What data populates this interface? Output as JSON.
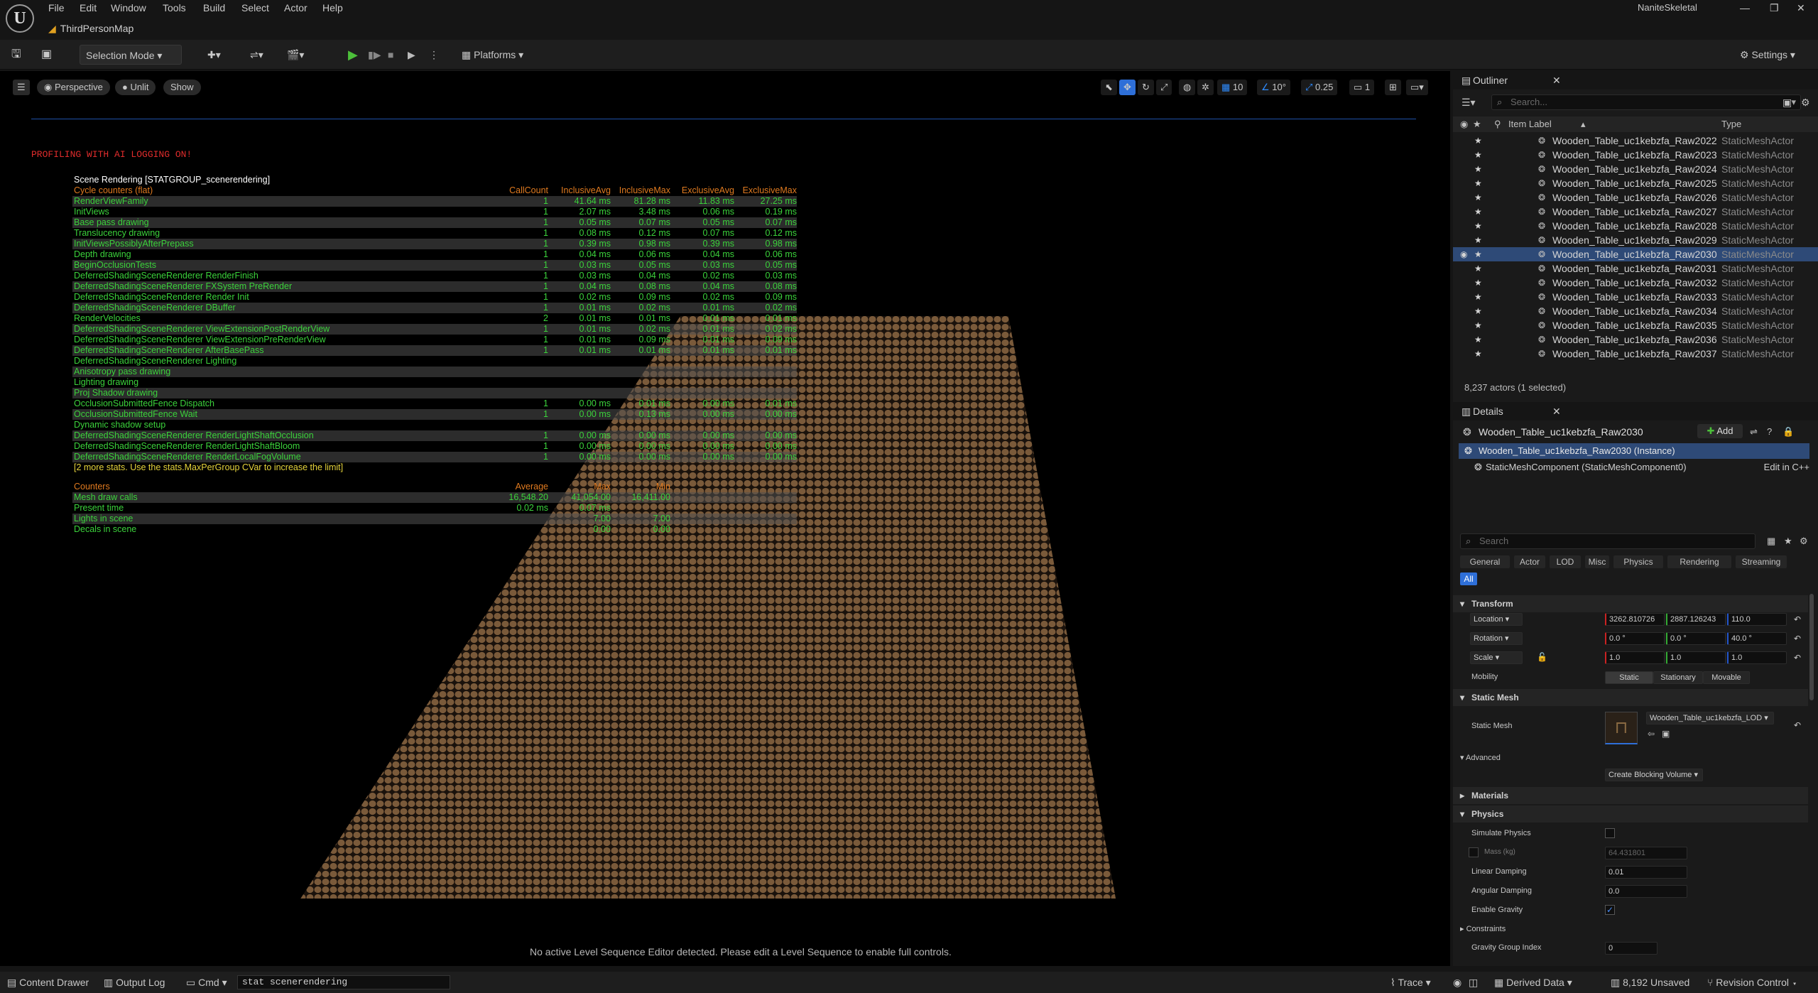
{
  "menu": {
    "file": "File",
    "edit": "Edit",
    "window": "Window",
    "tools": "Tools",
    "build": "Build",
    "select": "Select",
    "actor": "Actor",
    "help": "Help"
  },
  "project_name": "NaniteSkeletal",
  "map_tab": "ThirdPersonMap",
  "toolbar": {
    "selection_mode": "Selection Mode",
    "platforms": "Platforms",
    "settings": "Settings"
  },
  "viewport": {
    "perspective": "Perspective",
    "unlit": "Unlit",
    "show": "Show",
    "grid_snap": "10",
    "rot_snap": "10°",
    "scale_snap": "0.25",
    "cam_speed": "1",
    "profiling": "PROFILING WITH AI LOGGING ON!",
    "no_level_seq": "No active Level Sequence Editor detected. Please edit a Level Sequence to enable full controls."
  },
  "stats": {
    "group": "Scene Rendering [STATGROUP_scenerendering]",
    "cycle_header": "Cycle counters (flat)",
    "cols": [
      "CallCount",
      "InclusiveAvg",
      "InclusiveMax",
      "ExclusiveAvg",
      "ExclusiveMax"
    ],
    "rows": [
      [
        "RenderViewFamily",
        "1",
        "41.64 ms",
        "81.28 ms",
        "11.83 ms",
        "27.25 ms"
      ],
      [
        "InitViews",
        "1",
        "2.07 ms",
        "3.48 ms",
        "0.06 ms",
        "0.19 ms"
      ],
      [
        "Base pass drawing",
        "1",
        "0.05 ms",
        "0.07 ms",
        "0.05 ms",
        "0.07 ms"
      ],
      [
        "Translucency drawing",
        "1",
        "0.08 ms",
        "0.12 ms",
        "0.07 ms",
        "0.12 ms"
      ],
      [
        "InitViewsPossiblyAfterPrepass",
        "1",
        "0.39 ms",
        "0.98 ms",
        "0.39 ms",
        "0.98 ms"
      ],
      [
        "Depth drawing",
        "1",
        "0.04 ms",
        "0.06 ms",
        "0.04 ms",
        "0.06 ms"
      ],
      [
        "BeginOcclusionTests",
        "1",
        "0.03 ms",
        "0.05 ms",
        "0.03 ms",
        "0.05 ms"
      ],
      [
        "DeferredShadingSceneRenderer RenderFinish",
        "1",
        "0.03 ms",
        "0.04 ms",
        "0.02 ms",
        "0.03 ms"
      ],
      [
        "DeferredShadingSceneRenderer FXSystem PreRender",
        "1",
        "0.04 ms",
        "0.08 ms",
        "0.04 ms",
        "0.08 ms"
      ],
      [
        "DeferredShadingSceneRenderer Render Init",
        "1",
        "0.02 ms",
        "0.09 ms",
        "0.02 ms",
        "0.09 ms"
      ],
      [
        "DeferredShadingSceneRenderer DBuffer",
        "1",
        "0.01 ms",
        "0.02 ms",
        "0.01 ms",
        "0.02 ms"
      ],
      [
        "RenderVelocities",
        "2",
        "0.01 ms",
        "0.01 ms",
        "0.01 ms",
        "0.01 ms"
      ],
      [
        "DeferredShadingSceneRenderer ViewExtensionPostRenderView",
        "1",
        "0.01 ms",
        "0.02 ms",
        "0.01 ms",
        "0.02 ms"
      ],
      [
        "DeferredShadingSceneRenderer ViewExtensionPreRenderView",
        "1",
        "0.01 ms",
        "0.09 ms",
        "0.01 ms",
        "0.09 ms"
      ],
      [
        "DeferredShadingSceneRenderer AfterBasePass",
        "1",
        "0.01 ms",
        "0.01 ms",
        "0.01 ms",
        "0.01 ms"
      ],
      [
        "DeferredShadingSceneRenderer Lighting",
        "",
        "",
        "",
        "",
        ""
      ],
      [
        "Anisotropy pass drawing",
        "",
        "",
        "",
        "",
        ""
      ],
      [
        "Lighting drawing",
        "",
        "",
        "",
        "",
        ""
      ],
      [
        "Proj Shadow drawing",
        "",
        "",
        "",
        "",
        ""
      ],
      [
        "OcclusionSubmittedFence Dispatch",
        "1",
        "0.00 ms",
        "0.01 ms",
        "0.00 ms",
        "0.01 ms"
      ],
      [
        "OcclusionSubmittedFence Wait",
        "1",
        "0.00 ms",
        "0.13 ms",
        "0.00 ms",
        "0.00 ms"
      ],
      [
        "Dynamic shadow setup",
        "",
        "",
        "",
        "",
        ""
      ],
      [
        "DeferredShadingSceneRenderer RenderLightShaftOcclusion",
        "1",
        "0.00 ms",
        "0.00 ms",
        "0.00 ms",
        "0.00 ms"
      ],
      [
        "DeferredShadingSceneRenderer RenderLightShaftBloom",
        "1",
        "0.00 ms",
        "0.00 ms",
        "0.00 ms",
        "0.00 ms"
      ],
      [
        "DeferredShadingSceneRenderer RenderLocalFogVolume",
        "1",
        "0.00 ms",
        "0.00 ms",
        "0.00 ms",
        "0.00 ms"
      ]
    ],
    "more": "[2 more stats. Use the stats.MaxPerGroup CVar to increase the limit]",
    "counters_header": "Counters",
    "counter_cols": [
      "Average",
      "Max",
      "Min"
    ],
    "counters": [
      [
        "Mesh draw calls",
        "16,548.20",
        "41,054.00",
        "16,411.00"
      ],
      [
        "Present time",
        "0.02 ms",
        "0.07 ms",
        ""
      ],
      [
        "Lights in scene",
        "",
        "7.00",
        "7.00"
      ],
      [
        "Decals in scene",
        "",
        "0.00",
        "0.00"
      ]
    ]
  },
  "outliner": {
    "title": "Outliner",
    "search_placeholder": "Search...",
    "col_label": "Item Label",
    "col_type": "Type",
    "rows": [
      {
        "label": "Wooden_Table_uc1kebzfa_Raw2022",
        "type": "StaticMeshActor"
      },
      {
        "label": "Wooden_Table_uc1kebzfa_Raw2023",
        "type": "StaticMeshActor"
      },
      {
        "label": "Wooden_Table_uc1kebzfa_Raw2024",
        "type": "StaticMeshActor"
      },
      {
        "label": "Wooden_Table_uc1kebzfa_Raw2025",
        "type": "StaticMeshActor"
      },
      {
        "label": "Wooden_Table_uc1kebzfa_Raw2026",
        "type": "StaticMeshActor"
      },
      {
        "label": "Wooden_Table_uc1kebzfa_Raw2027",
        "type": "StaticMeshActor"
      },
      {
        "label": "Wooden_Table_uc1kebzfa_Raw2028",
        "type": "StaticMeshActor"
      },
      {
        "label": "Wooden_Table_uc1kebzfa_Raw2029",
        "type": "StaticMeshActor"
      },
      {
        "label": "Wooden_Table_uc1kebzfa_Raw2030",
        "type": "StaticMeshActor"
      },
      {
        "label": "Wooden_Table_uc1kebzfa_Raw2031",
        "type": "StaticMeshActor"
      },
      {
        "label": "Wooden_Table_uc1kebzfa_Raw2032",
        "type": "StaticMeshActor"
      },
      {
        "label": "Wooden_Table_uc1kebzfa_Raw2033",
        "type": "StaticMeshActor"
      },
      {
        "label": "Wooden_Table_uc1kebzfa_Raw2034",
        "type": "StaticMeshActor"
      },
      {
        "label": "Wooden_Table_uc1kebzfa_Raw2035",
        "type": "StaticMeshActor"
      },
      {
        "label": "Wooden_Table_uc1kebzfa_Raw2036",
        "type": "StaticMeshActor"
      },
      {
        "label": "Wooden_Table_uc1kebzfa_Raw2037",
        "type": "StaticMeshActor"
      }
    ],
    "footer": "8,237 actors (1 selected)"
  },
  "details": {
    "title": "Details",
    "actor_name": "Wooden_Table_uc1kebzfa_Raw2030",
    "add": "Add",
    "instance": "Wooden_Table_uc1kebzfa_Raw2030 (Instance)",
    "component": "StaticMeshComponent (StaticMeshComponent0)",
    "edit_cpp": "Edit in C++",
    "search_placeholder": "Search",
    "categories": [
      "General",
      "Actor",
      "LOD",
      "Misc",
      "Physics",
      "Rendering",
      "Streaming",
      "All"
    ],
    "transform": "Transform",
    "location": "Location",
    "loc": [
      "3262.810726",
      "2887.126243",
      "110.0"
    ],
    "rotation": "Rotation",
    "rot": [
      "0.0 °",
      "0.0 °",
      "40.0 °"
    ],
    "scale": "Scale",
    "scl": [
      "1.0",
      "1.0",
      "1.0"
    ],
    "mobility": "Mobility",
    "mob": [
      "Static",
      "Stationary",
      "Movable"
    ],
    "static_mesh_sec": "Static Mesh",
    "static_mesh_label": "Static Mesh",
    "static_mesh_value": "Wooden_Table_uc1kebzfa_LOD",
    "advanced": "Advanced",
    "blocking": "Create Blocking Volume",
    "materials": "Materials",
    "physics": "Physics",
    "simulate": "Simulate Physics",
    "mass": "Mass (kg)",
    "mass_val": "64.431801",
    "lin_damp": "Linear Damping",
    "lin_damp_val": "0.01",
    "ang_damp": "Angular Damping",
    "ang_damp_val": "0.0",
    "gravity": "Enable Gravity",
    "constraints": "Constraints",
    "grav_group": "Gravity Group Index",
    "grav_group_val": "0"
  },
  "statusbar": {
    "content_drawer": "Content Drawer",
    "output_log": "Output Log",
    "cmd": "Cmd",
    "cmd_value": "stat scenerendering",
    "trace": "Trace",
    "derived": "Derived Data",
    "unsaved": "8,192 Unsaved",
    "revision": "Revision Control"
  },
  "colors": {
    "accent": "#2e6fd8",
    "stat_green": "#3bd23b",
    "stat_orange": "#e07a1f",
    "profiling_red": "#e02c2c",
    "table_brown": "#7a5a3a"
  }
}
